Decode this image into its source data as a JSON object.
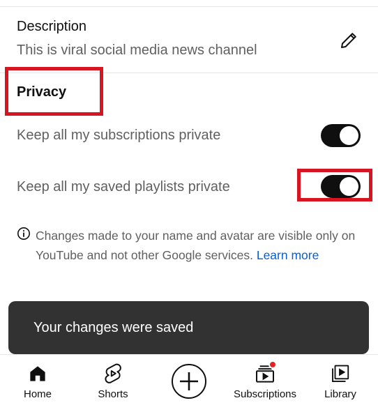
{
  "description": {
    "title": "Description",
    "text": "This is viral social media news channel",
    "edit_icon": "pencil-icon"
  },
  "privacy": {
    "title": "Privacy",
    "settings": [
      {
        "label": "Keep all my subscriptions private",
        "enabled": true
      },
      {
        "label": "Keep all my saved playlists private",
        "enabled": true
      }
    ],
    "info_icon": "info-icon",
    "info_text": "Changes made to your name and avatar are visible only on YouTube and not other Google services.",
    "learn_more": "Learn more"
  },
  "snackbar": {
    "message": "Your changes were saved"
  },
  "nav": {
    "home": "Home",
    "shorts": "Shorts",
    "create_icon": "plus-circle-icon",
    "subscriptions": "Subscriptions",
    "library": "Library"
  },
  "colors": {
    "toggle_on": "#0f0f0f",
    "link": "#065fd4",
    "highlight": "#d7141f",
    "notification": "#e52222",
    "snackbar_bg": "#323232"
  }
}
